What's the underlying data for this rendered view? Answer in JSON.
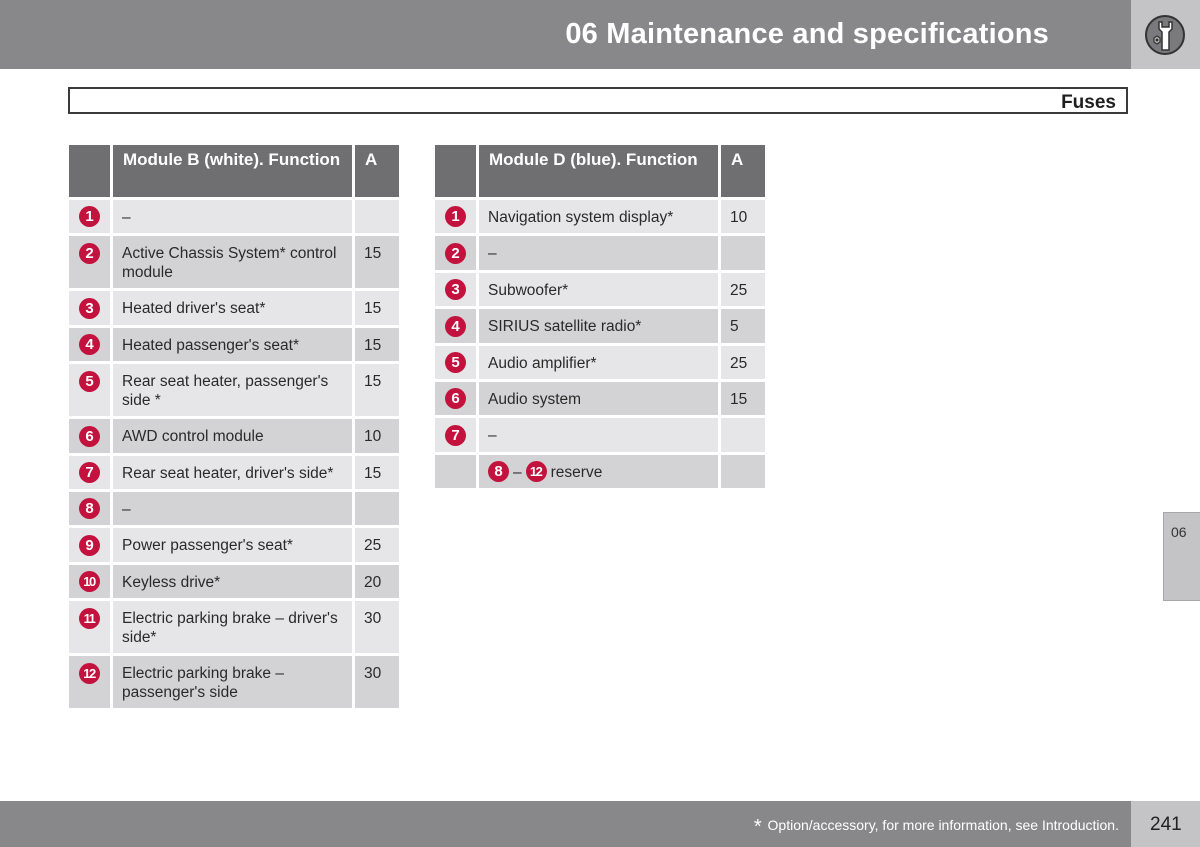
{
  "header": {
    "title": "06 Maintenance and specifications",
    "icon": "wrench-nut-icon"
  },
  "section": {
    "title": "Fuses"
  },
  "table_left": {
    "headers": {
      "num": "",
      "function": "Module B (white). Function",
      "amps": "A"
    },
    "rows": [
      {
        "num": "1",
        "function": "–",
        "amps": ""
      },
      {
        "num": "2",
        "function": "Active Chassis System* control module",
        "amps": "15"
      },
      {
        "num": "3",
        "function": "Heated driver's seat*",
        "amps": "15"
      },
      {
        "num": "4",
        "function": "Heated passenger's seat*",
        "amps": "15"
      },
      {
        "num": "5",
        "function": "Rear seat heater, passenger's side *",
        "amps": "15"
      },
      {
        "num": "6",
        "function": "AWD control module",
        "amps": "10"
      },
      {
        "num": "7",
        "function": "Rear seat heater, driver's side*",
        "amps": "15"
      },
      {
        "num": "8",
        "function": "–",
        "amps": ""
      },
      {
        "num": "9",
        "function": "Power passenger's seat*",
        "amps": "25"
      },
      {
        "num": "10",
        "function": "Keyless drive*",
        "amps": "20"
      },
      {
        "num": "11",
        "function": "Electric parking brake – driver's side*",
        "amps": "30"
      },
      {
        "num": "12",
        "function": "Electric parking brake – passenger's side",
        "amps": "30"
      }
    ]
  },
  "table_right": {
    "headers": {
      "num": "",
      "function": "Module D (blue). Function",
      "amps": "A"
    },
    "rows": [
      {
        "num": "1",
        "function": "Navigation system display*",
        "amps": "10"
      },
      {
        "num": "2",
        "function": "–",
        "amps": ""
      },
      {
        "num": "3",
        "function": "Subwoofer*",
        "amps": "25"
      },
      {
        "num": "4",
        "function": "SIRIUS satellite radio*",
        "amps": "5"
      },
      {
        "num": "5",
        "function": "Audio amplifier*",
        "amps": "25"
      },
      {
        "num": "6",
        "function": "Audio system",
        "amps": "15"
      },
      {
        "num": "7",
        "function": "–",
        "amps": ""
      }
    ],
    "reserve": {
      "from": "8",
      "separator": "–",
      "to": "12",
      "label": "reserve",
      "amps": ""
    }
  },
  "side_tab": {
    "label": "06"
  },
  "footer": {
    "star": "*",
    "note": "Option/accessory, for more information, see Introduction.",
    "page_number": "241"
  },
  "colors": {
    "badge": "#c2123d",
    "header_bar": "#88888b",
    "table_header": "#6f6f72"
  }
}
